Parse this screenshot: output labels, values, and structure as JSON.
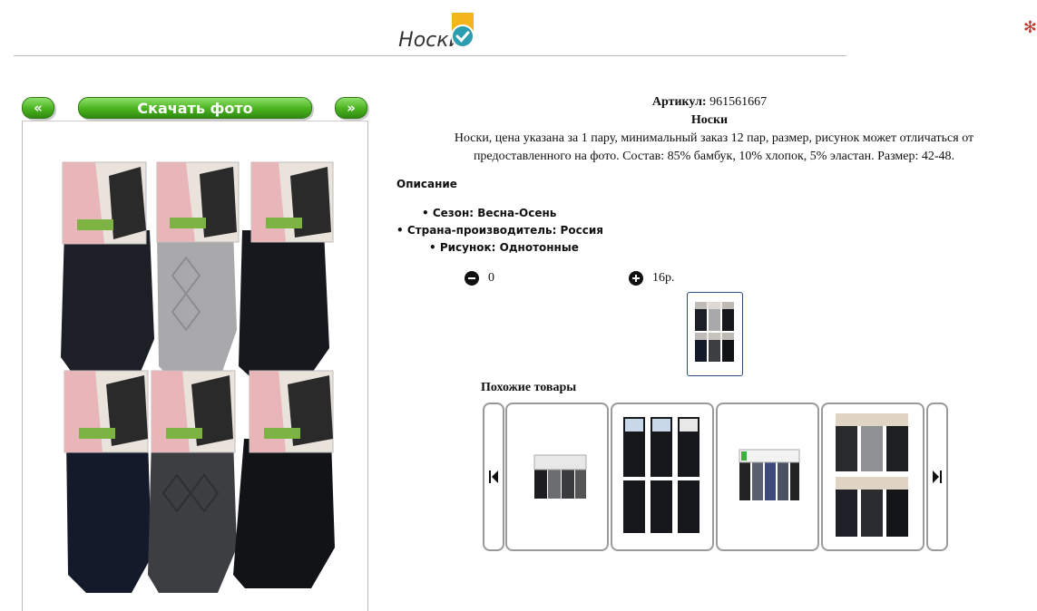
{
  "page": {
    "title": "Носки"
  },
  "gallery": {
    "prev_label": "«",
    "download_label": "Скачать фото",
    "next_label": "»"
  },
  "product": {
    "article_label": "Артикул:",
    "article_value": "961561667",
    "name": "Носки",
    "description_text": "Носки, цена указана за 1 пару, минимальный заказ 12 пар, размер, рисунок может отличаться от предоставленного на фото. Состав: 85% бамбук, 10% хлопок, 5% эластан. Размер: 42-48."
  },
  "description": {
    "heading": "Описание",
    "specs": [
      "• Сезон: Весна-Осень",
      "• Страна-производитель: Россия",
      "• Рисунок: Однотонные"
    ]
  },
  "order": {
    "quantity": "0",
    "price": "16р."
  },
  "similar": {
    "heading": "Похожие товары"
  },
  "colors": {
    "accent_green": "#4ab21e",
    "sock_dark": "#1a1c22",
    "sock_grey": "#a9a9ab",
    "thumb_border": "#2a4f7a"
  }
}
